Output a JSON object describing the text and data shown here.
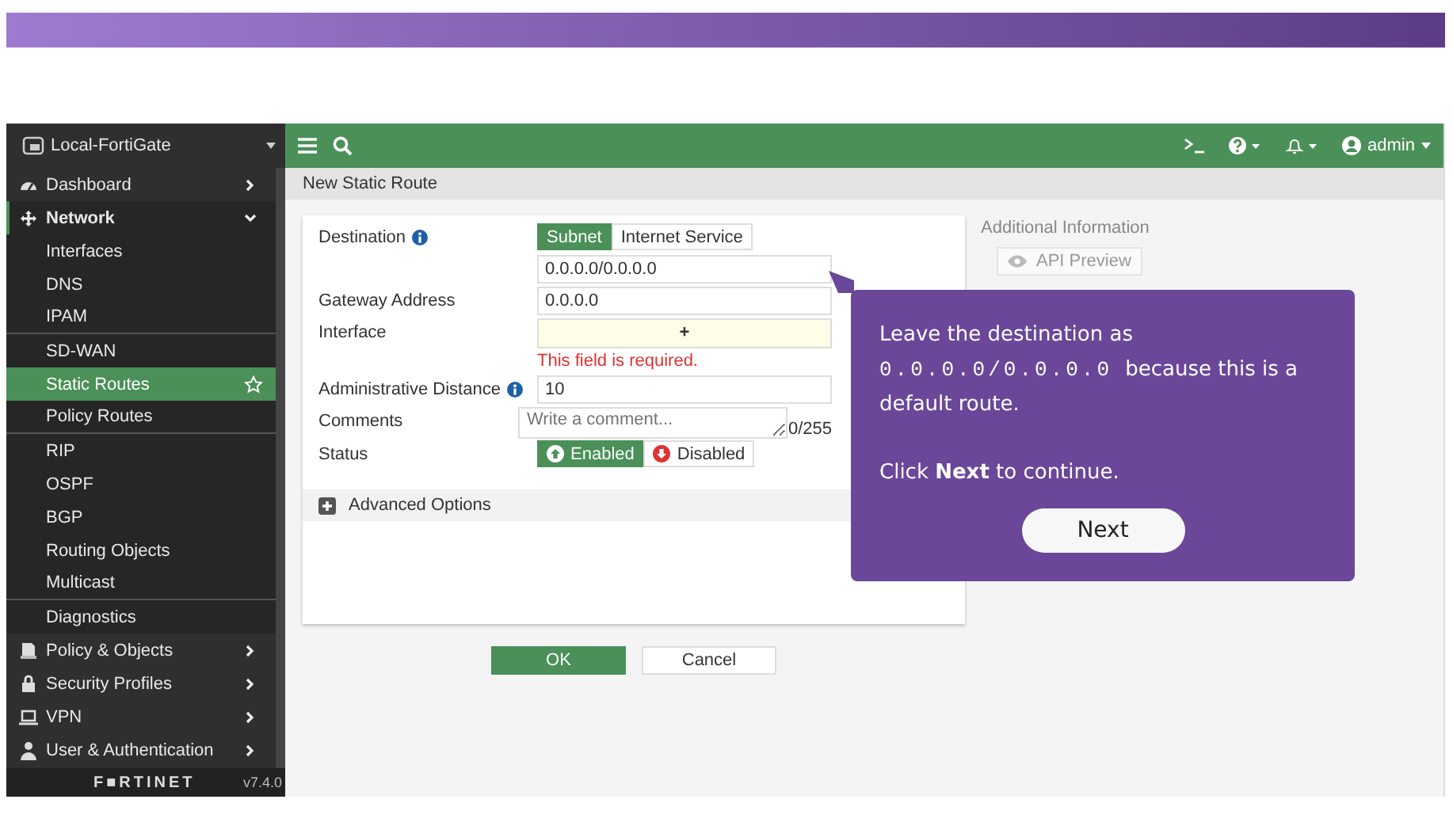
{
  "sidebar": {
    "device": "Local-FortiGate",
    "items": [
      {
        "label": "Dashboard",
        "expanded": false
      },
      {
        "label": "Network",
        "expanded": true,
        "children": [
          {
            "label": "Interfaces",
            "selected": false,
            "separator": false
          },
          {
            "label": "DNS",
            "selected": false,
            "separator": false
          },
          {
            "label": "IPAM",
            "selected": false,
            "separator": true
          },
          {
            "label": "SD-WAN",
            "selected": false,
            "separator": false
          },
          {
            "label": "Static Routes",
            "selected": true,
            "separator": false
          },
          {
            "label": "Policy Routes",
            "selected": false,
            "separator": true
          },
          {
            "label": "RIP",
            "selected": false,
            "separator": false
          },
          {
            "label": "OSPF",
            "selected": false,
            "separator": false
          },
          {
            "label": "BGP",
            "selected": false,
            "separator": false
          },
          {
            "label": "Routing Objects",
            "selected": false,
            "separator": false
          },
          {
            "label": "Multicast",
            "selected": false,
            "separator": true
          },
          {
            "label": "Diagnostics",
            "selected": false,
            "separator": false
          }
        ]
      },
      {
        "label": "Policy & Objects",
        "expanded": false
      },
      {
        "label": "Security Profiles",
        "expanded": false
      },
      {
        "label": "VPN",
        "expanded": false
      },
      {
        "label": "User & Authentication",
        "expanded": false
      }
    ],
    "brand": "F■RTINET",
    "version": "v7.4.0"
  },
  "topbar": {
    "user": "admin"
  },
  "breadcrumb": "New Static Route",
  "form": {
    "rows": [
      {
        "kind": "toggle",
        "label": "Destination",
        "info": true,
        "options": [
          {
            "label": "Subnet",
            "selected": true
          },
          {
            "label": "Internet Service",
            "selected": false
          }
        ]
      },
      {
        "kind": "input",
        "value": "0.0.0.0/0.0.0.0"
      },
      {
        "kind": "input",
        "label": "Gateway Address",
        "value": "0.0.0.0"
      },
      {
        "kind": "select",
        "label": "Interface",
        "value": "+",
        "error": "This field is required."
      },
      {
        "kind": "input",
        "label": "Administrative Distance",
        "info": true,
        "value": "10"
      },
      {
        "kind": "textarea",
        "label": "Comments",
        "placeholder": "Write a comment...",
        "counter": "0/255"
      },
      {
        "kind": "status",
        "label": "Status",
        "options": [
          {
            "label": "Enabled",
            "selected": true
          },
          {
            "label": "Disabled",
            "selected": false
          }
        ]
      }
    ],
    "advanced": "Advanced Options"
  },
  "buttons": [
    {
      "label": "OK",
      "primary": true
    },
    {
      "label": "Cancel",
      "primary": false
    }
  ],
  "side_info": {
    "title": "Additional Information",
    "button": "API Preview"
  },
  "tooltip": {
    "lines": [
      {
        "text": "Leave the destination as ",
        "code": "0.0.0.0/0.0.0.0",
        "after": " because this is a default route."
      },
      {
        "text": "Click **Next** to continue."
      }
    ],
    "button": "Next"
  }
}
